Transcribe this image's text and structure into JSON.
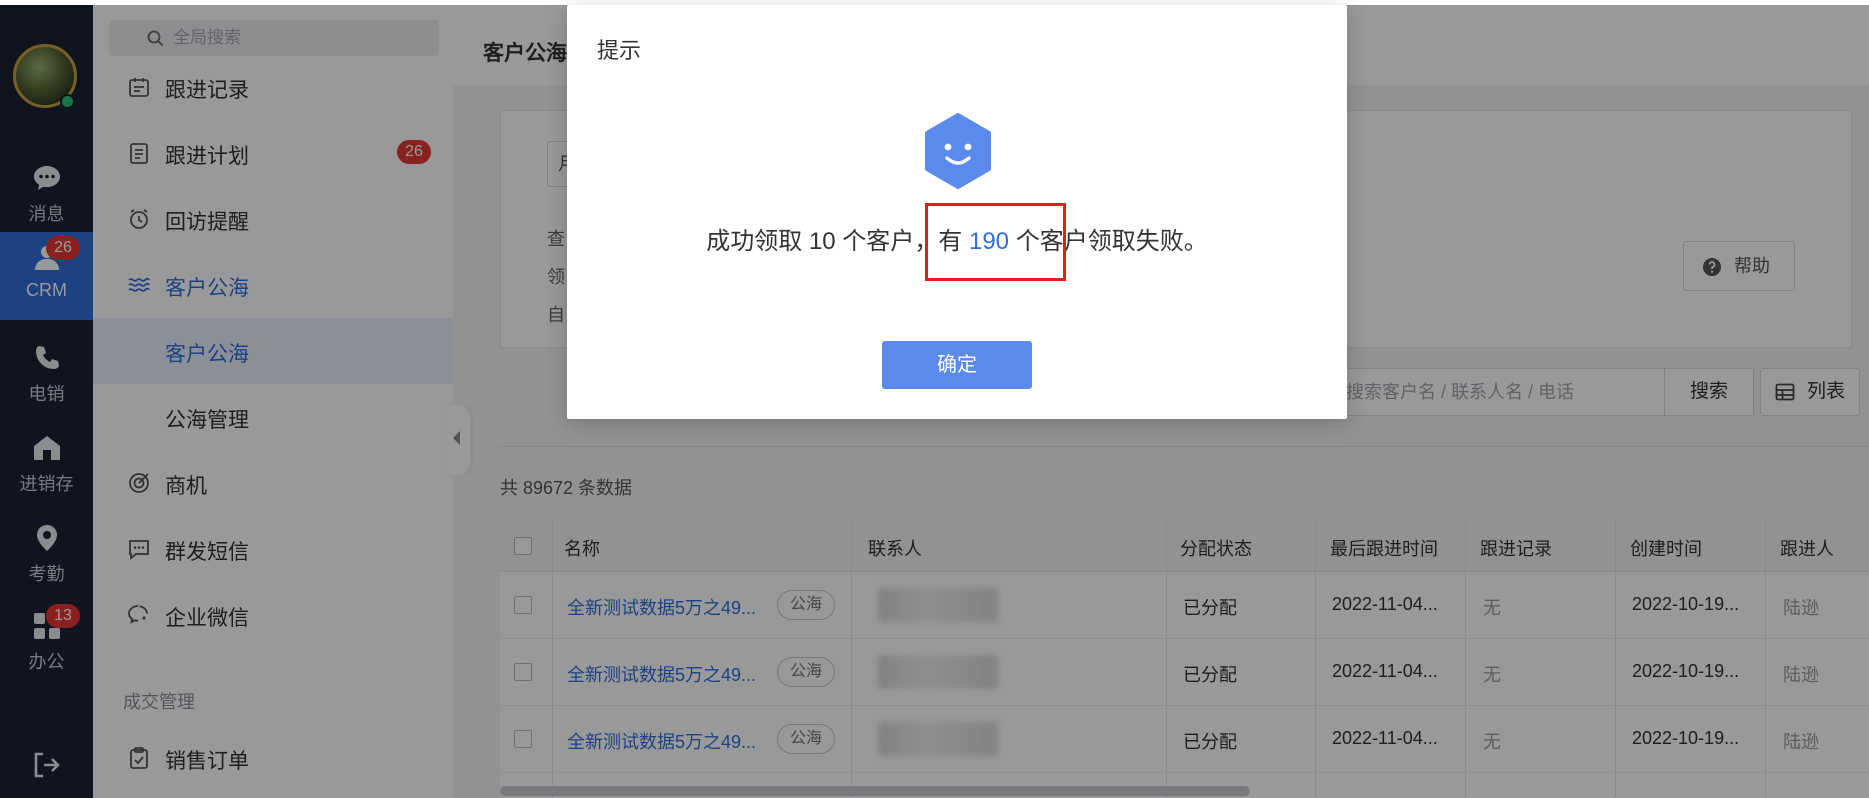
{
  "rail": {
    "items": [
      {
        "label": "消息",
        "icon": "chat-bubble-icon"
      },
      {
        "label": "CRM",
        "icon": "crm-user-icon",
        "badge": "26"
      },
      {
        "label": "电销",
        "icon": "phone-icon"
      },
      {
        "label": "进销存",
        "icon": "warehouse-icon"
      },
      {
        "label": "考勤",
        "icon": "location-pin-icon"
      },
      {
        "label": "办公",
        "icon": "apps-grid-icon",
        "badge": "13"
      }
    ],
    "active_color": "#2f6fdb"
  },
  "sidebar": {
    "search_placeholder": "全局搜索",
    "items": [
      {
        "label": "跟进记录",
        "icon": "calendar-icon"
      },
      {
        "label": "跟进计划",
        "icon": "checklist-icon",
        "badge": "26"
      },
      {
        "label": "回访提醒",
        "icon": "alarm-clock-icon"
      },
      {
        "label": "客户公海",
        "icon": "waves-icon"
      },
      {
        "label": "客户公海"
      },
      {
        "label": "公海管理"
      },
      {
        "label": "商机",
        "icon": "target-icon"
      },
      {
        "label": "群发短信",
        "icon": "message-dots-icon"
      },
      {
        "label": "企业微信",
        "icon": "wechat-work-icon"
      }
    ],
    "section_title": "成交管理",
    "section_items": [
      {
        "label": "销售订单",
        "icon": "clipboard-check-icon"
      }
    ]
  },
  "main": {
    "page_title": "客户公海",
    "select_value": "月",
    "info_lines": [
      "查",
      "领",
      "自"
    ],
    "help_label": "帮助",
    "search_placeholder": "搜索客户名 / 联系人名 / 电话",
    "search_label": "搜索",
    "list_label": "列表",
    "total_text": "共 89672 条数据",
    "table": {
      "columns": [
        "名称",
        "联系人",
        "分配状态",
        "最后跟进时间",
        "跟进记录",
        "创建时间",
        "跟进人"
      ],
      "rows": [
        {
          "name": "全新测试数据5万之49...",
          "tag": "公海",
          "status": "已分配",
          "last_follow": "2022-11-04...",
          "record": "无",
          "created": "2022-10-19...",
          "owner": "陆逊"
        },
        {
          "name": "全新测试数据5万之49...",
          "tag": "公海",
          "status": "已分配",
          "last_follow": "2022-11-04...",
          "record": "无",
          "created": "2022-10-19...",
          "owner": "陆逊"
        },
        {
          "name": "全新测试数据5万之49...",
          "tag": "公海",
          "status": "已分配",
          "last_follow": "2022-11-04...",
          "record": "无",
          "created": "2022-10-19...",
          "owner": "陆逊"
        }
      ]
    }
  },
  "dialog": {
    "title": "提示",
    "message_prefix": "成功领取 10 个客户，有 ",
    "failed_count": "190",
    "message_suffix": " 个客户领取失败。",
    "ok_label": "确定",
    "highlight_color": "#e31d1d",
    "accent_color": "#5a8aee"
  }
}
